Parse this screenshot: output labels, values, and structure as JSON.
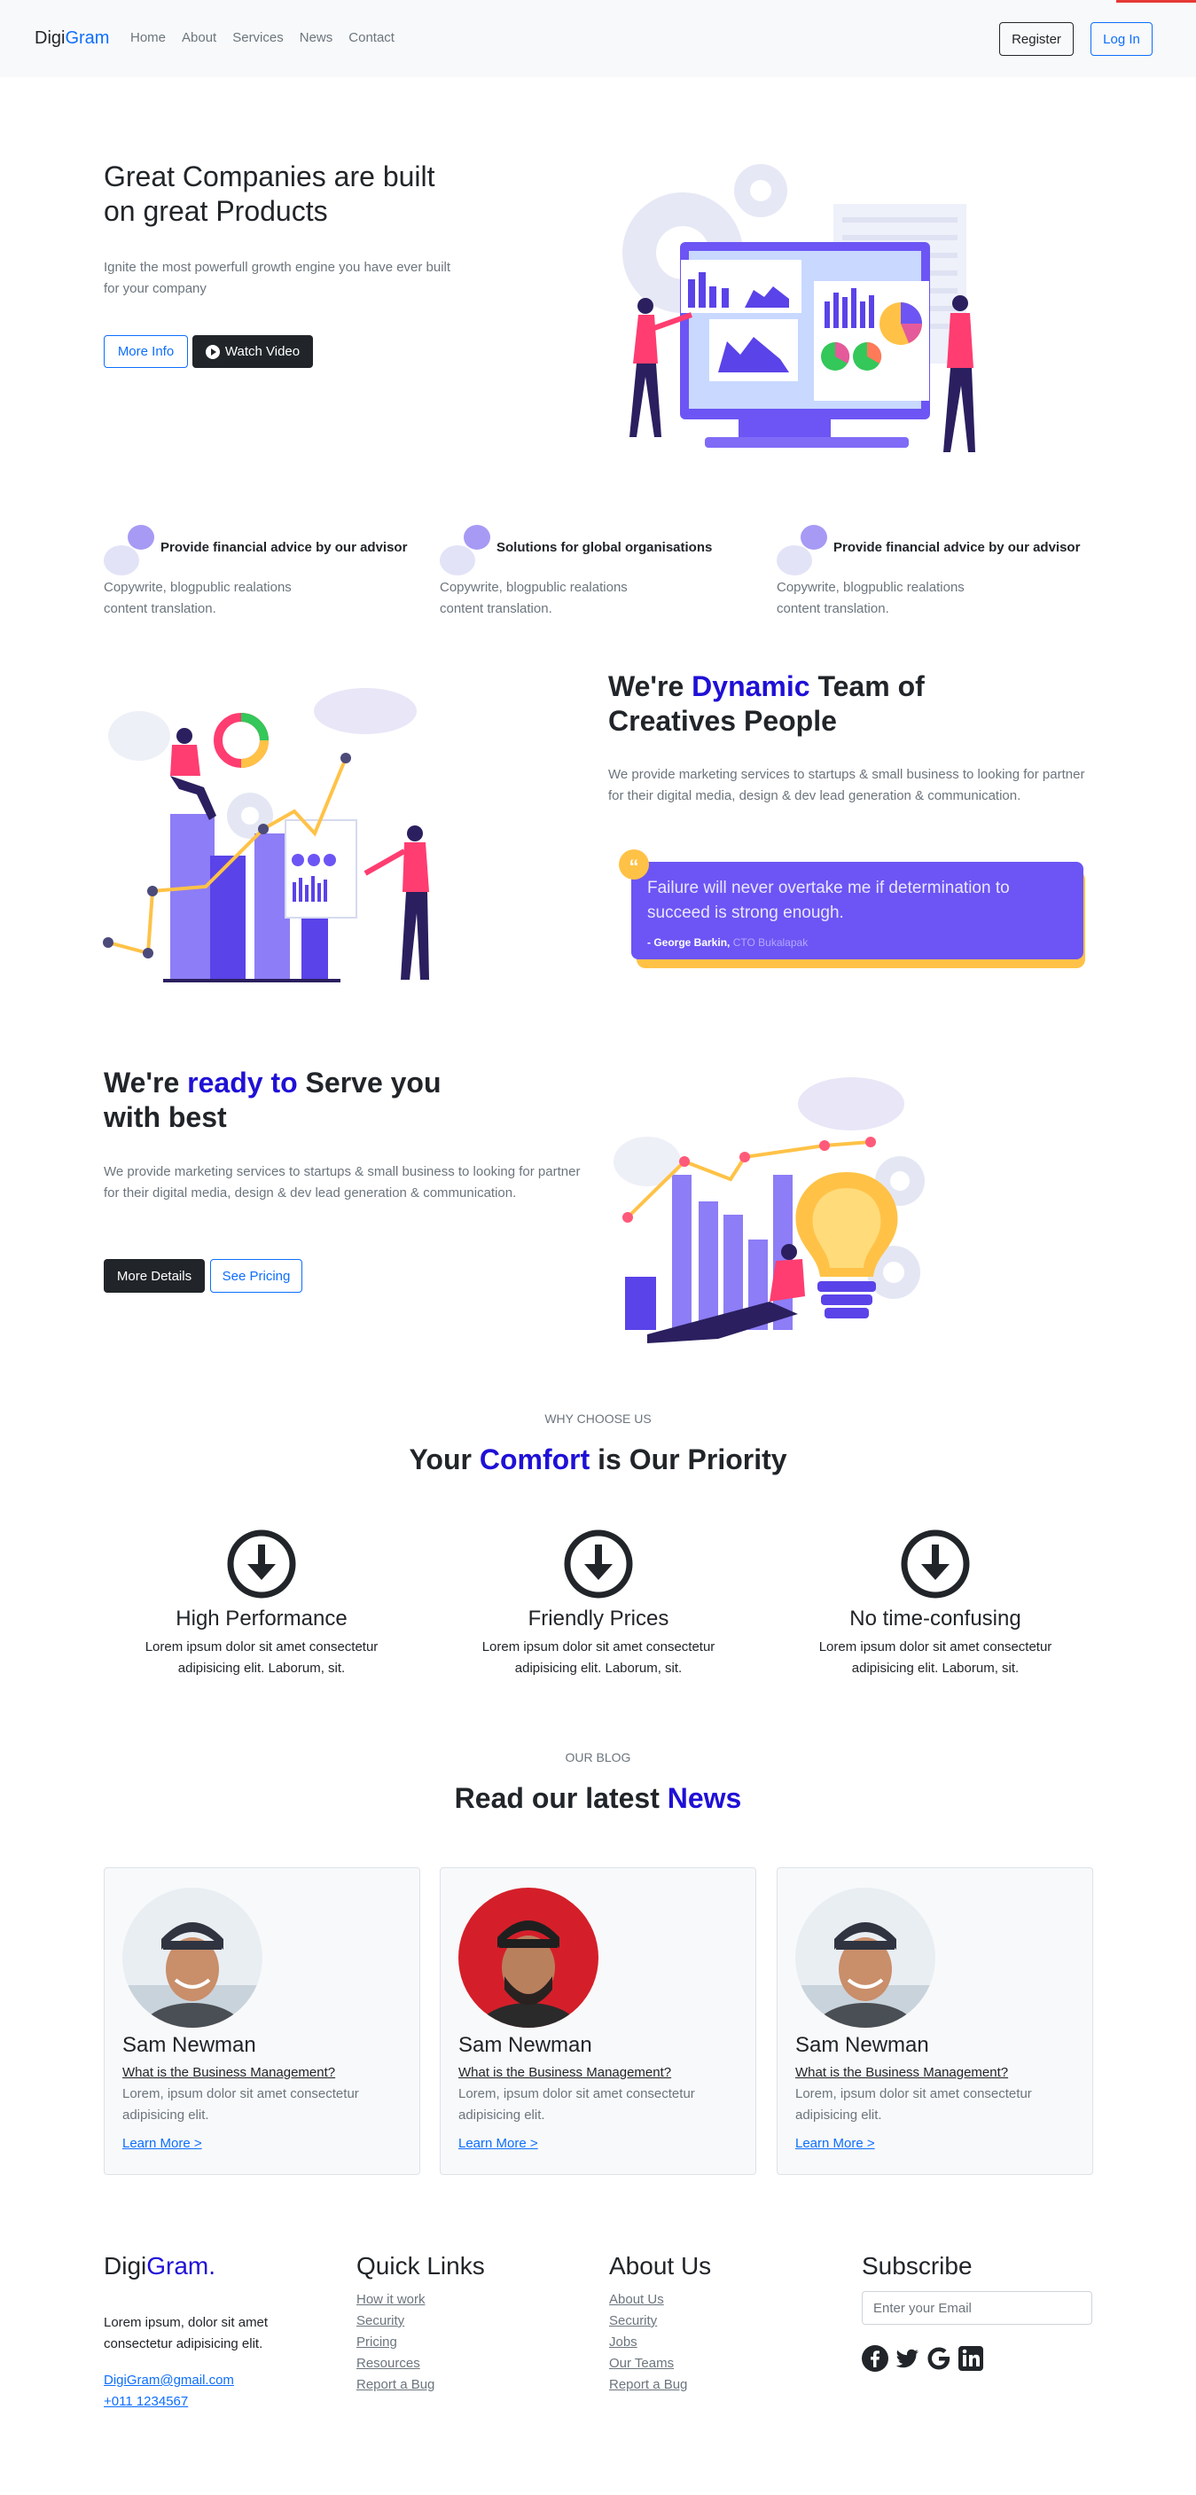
{
  "nav": {
    "brand_part1": "Digi",
    "brand_part2": "Gram",
    "links": [
      "Home",
      "About",
      "Services",
      "News",
      "Contact"
    ],
    "register_label": "Register",
    "login_label": "Log In"
  },
  "hero": {
    "title": "Great Companies are built on great Products",
    "subtitle": "Ignite the most powerfull growth engine you have ever built for your company",
    "more_info_label": "More Info",
    "watch_video_label": "Watch Video"
  },
  "features": [
    {
      "title": "Provide financial advice by our advisor",
      "desc": "Copywrite, blogpublic realations content translation."
    },
    {
      "title": "Solutions for global organisations",
      "desc": "Copywrite, blogpublic realations content translation."
    },
    {
      "title": "Provide financial advice by our advisor",
      "desc": "Copywrite, blogpublic realations content translation."
    }
  ],
  "dynamic": {
    "title_pre": "We're ",
    "title_hl": "Dynamic",
    "title_post": " Team of Creatives People",
    "desc": "We provide marketing services to startups & small business to looking for partner for their digital media, design & dev lead generation & communication.",
    "quote": "Failure will never overtake me if determination to succeed is strong enough.",
    "quote_author": "- George Barkin,",
    "quote_role": "CTO Bukalapak"
  },
  "ready": {
    "title_pre": "We're ",
    "title_hl": "ready to",
    "title_post": " Serve you with best",
    "desc": "We provide marketing services to startups & small business to looking for partner for their digital media, design & dev lead generation & communication.",
    "details_label": "More Details",
    "pricing_label": "See Pricing"
  },
  "why": {
    "eyebrow": "WHY CHOOSE US",
    "title_pre": "Your ",
    "title_hl": "Comfort",
    "title_post": " is Our Priority",
    "items": [
      {
        "title": "High Performance",
        "desc": "Lorem ipsum dolor sit amet consectetur adipisicing elit. Laborum, sit."
      },
      {
        "title": "Friendly Prices",
        "desc": "Lorem ipsum dolor sit amet consectetur adipisicing elit. Laborum, sit."
      },
      {
        "title": "No time-confusing",
        "desc": "Lorem ipsum dolor sit amet consectetur adipisicing elit. Laborum, sit."
      }
    ]
  },
  "blog": {
    "eyebrow": "OUR BLOG",
    "title_pre": "Read our latest ",
    "title_hl": "News",
    "cards": [
      {
        "name": "Sam Newman",
        "question": "What is the Business Management?",
        "desc": "Lorem, ipsum dolor sit amet consectetur adipisicing elit.",
        "link": "Learn More >"
      },
      {
        "name": "Sam Newman",
        "question": "What is the Business Management?",
        "desc": "Lorem, ipsum dolor sit amet consectetur adipisicing elit.",
        "link": "Learn More >"
      },
      {
        "name": "Sam Newman",
        "question": "What is the Business Management?",
        "desc": "Lorem, ipsum dolor sit amet consectetur adipisicing elit.",
        "link": "Learn More >"
      }
    ]
  },
  "footer": {
    "brand_part1": "Digi",
    "brand_part2": "Gram.",
    "text": "Lorem ipsum, dolor sit amet consectetur adipisicing elit.",
    "email": "DigiGram@gmail.com",
    "phone": "+011 1234567",
    "quick_links_title": "Quick Links",
    "quick_links": [
      "How it work",
      "Security",
      "Pricing",
      "Resources",
      "Report a Bug"
    ],
    "about_title": "About Us",
    "about_links": [
      "About Us",
      "Security",
      "Jobs",
      "Our Teams",
      "Report a Bug"
    ],
    "subscribe_title": "Subscribe",
    "email_placeholder": "Enter your Email",
    "socials": [
      "facebook-icon",
      "twitter-icon",
      "google-icon",
      "linkedin-icon"
    ]
  },
  "colors": {
    "accent": "#1f10d6",
    "link": "#0d6efd",
    "illustration_purple": "#6c55f4",
    "quote_yellow": "#ffc247"
  }
}
